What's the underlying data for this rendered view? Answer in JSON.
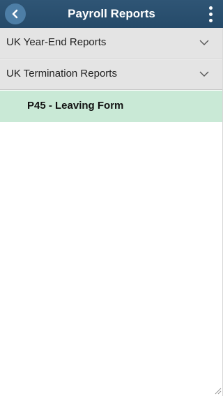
{
  "header": {
    "title": "Payroll Reports",
    "back_icon": "chevron-left-icon",
    "menu_icon": "kebab-menu-icon",
    "bar_color": "#2a4f6f"
  },
  "sections": [
    {
      "label": "UK Year-End Reports",
      "icon": "chevron-down-icon"
    },
    {
      "label": "UK Termination Reports",
      "icon": "chevron-down-icon"
    }
  ],
  "selected_item": {
    "label": "P45 - Leaving Form",
    "highlight_color": "#c9e9d6"
  }
}
